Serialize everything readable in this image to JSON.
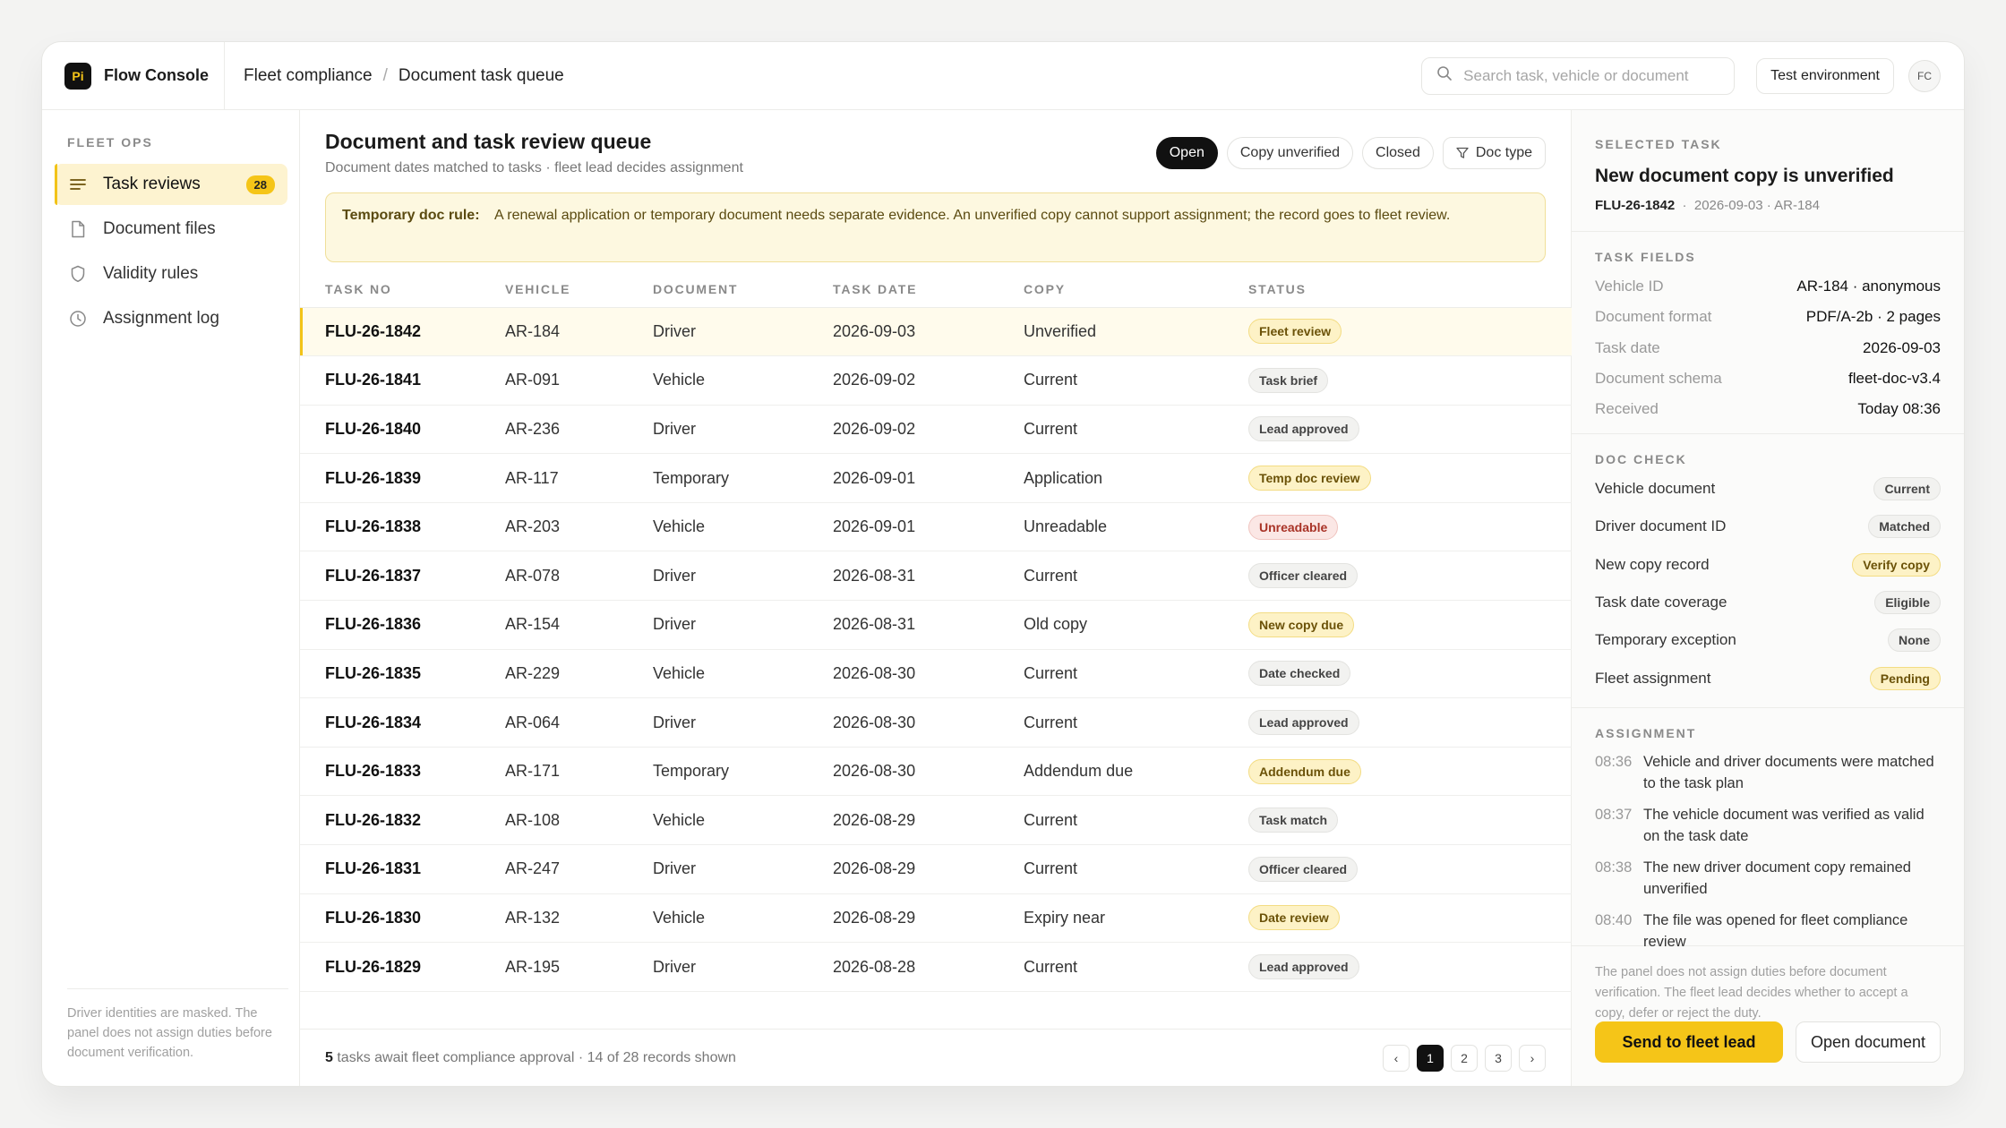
{
  "app": {
    "logo_text": "Pi",
    "name": "Flow Console"
  },
  "breadcrumb": [
    "Fleet compliance",
    "Document task queue"
  ],
  "search": {
    "placeholder": "Search task, vehicle or document",
    "value": ""
  },
  "environment_label": "Test environment",
  "avatar_initials": "FC",
  "sidebar": {
    "section_title": "FLEET OPS",
    "items": [
      {
        "label": "Task reviews",
        "icon": "list-icon",
        "badge": "28",
        "active": true
      },
      {
        "label": "Document files",
        "icon": "file-icon"
      },
      {
        "label": "Validity rules",
        "icon": "shield-icon"
      },
      {
        "label": "Assignment log",
        "icon": "clock-icon"
      }
    ],
    "note": "Driver identities are masked. The panel does not assign duties before document verification."
  },
  "main": {
    "title": "Document and task review queue",
    "subtitle": "Document dates matched to tasks · fleet lead decides assignment",
    "filters": [
      {
        "label": "Open",
        "active": true
      },
      {
        "label": "Copy unverified"
      },
      {
        "label": "Closed"
      },
      {
        "label": "Doc type",
        "icon": "filter-icon"
      }
    ],
    "rule": {
      "label": "Temporary doc rule:",
      "text": "A renewal application or temporary document needs separate evidence. An unverified copy cannot support assignment; the record goes to fleet review."
    },
    "columns": [
      "TASK NO",
      "VEHICLE",
      "DOCUMENT",
      "TASK DATE",
      "COPY",
      "STATUS"
    ],
    "rows": [
      {
        "task": "FLU-26-1842",
        "vehicle": "AR-184",
        "document": "Driver",
        "date": "2026-09-03",
        "copy": "Unverified",
        "status": "Fleet review",
        "tone": "yellow",
        "selected": true
      },
      {
        "task": "FLU-26-1841",
        "vehicle": "AR-091",
        "document": "Vehicle",
        "date": "2026-09-02",
        "copy": "Current",
        "status": "Task brief",
        "tone": "gray"
      },
      {
        "task": "FLU-26-1840",
        "vehicle": "AR-236",
        "document": "Driver",
        "date": "2026-09-02",
        "copy": "Current",
        "status": "Lead approved",
        "tone": "gray"
      },
      {
        "task": "FLU-26-1839",
        "vehicle": "AR-117",
        "document": "Temporary",
        "date": "2026-09-01",
        "copy": "Application",
        "status": "Temp doc review",
        "tone": "yellow"
      },
      {
        "task": "FLU-26-1838",
        "vehicle": "AR-203",
        "document": "Vehicle",
        "date": "2026-09-01",
        "copy": "Unreadable",
        "status": "Unreadable",
        "tone": "red"
      },
      {
        "task": "FLU-26-1837",
        "vehicle": "AR-078",
        "document": "Driver",
        "date": "2026-08-31",
        "copy": "Current",
        "status": "Officer cleared",
        "tone": "gray"
      },
      {
        "task": "FLU-26-1836",
        "vehicle": "AR-154",
        "document": "Driver",
        "date": "2026-08-31",
        "copy": "Old copy",
        "status": "New copy due",
        "tone": "yellow"
      },
      {
        "task": "FLU-26-1835",
        "vehicle": "AR-229",
        "document": "Vehicle",
        "date": "2026-08-30",
        "copy": "Current",
        "status": "Date checked",
        "tone": "gray"
      },
      {
        "task": "FLU-26-1834",
        "vehicle": "AR-064",
        "document": "Driver",
        "date": "2026-08-30",
        "copy": "Current",
        "status": "Lead approved",
        "tone": "gray"
      },
      {
        "task": "FLU-26-1833",
        "vehicle": "AR-171",
        "document": "Temporary",
        "date": "2026-08-30",
        "copy": "Addendum due",
        "status": "Addendum due",
        "tone": "yellow"
      },
      {
        "task": "FLU-26-1832",
        "vehicle": "AR-108",
        "document": "Vehicle",
        "date": "2026-08-29",
        "copy": "Current",
        "status": "Task match",
        "tone": "gray"
      },
      {
        "task": "FLU-26-1831",
        "vehicle": "AR-247",
        "document": "Driver",
        "date": "2026-08-29",
        "copy": "Current",
        "status": "Officer cleared",
        "tone": "gray"
      },
      {
        "task": "FLU-26-1830",
        "vehicle": "AR-132",
        "document": "Vehicle",
        "date": "2026-08-29",
        "copy": "Expiry near",
        "status": "Date review",
        "tone": "yellow"
      },
      {
        "task": "FLU-26-1829",
        "vehicle": "AR-195",
        "document": "Driver",
        "date": "2026-08-28",
        "copy": "Current",
        "status": "Lead approved",
        "tone": "gray"
      }
    ],
    "footer": {
      "count": "5",
      "text": " tasks await fleet compliance approval · 14 of 28 records shown"
    },
    "pager": {
      "prev": "‹",
      "pages": [
        "1",
        "2",
        "3"
      ],
      "current": "1",
      "next": "›"
    }
  },
  "panel": {
    "selected_label": "SELECTED TASK",
    "title": "New document copy is unverified",
    "task_id": "FLU-26-1842",
    "meta": "2026-09-03 · AR-184",
    "fields_label": "TASK FIELDS",
    "fields": [
      {
        "key": "Vehicle ID",
        "value": "AR-184 · anonymous"
      },
      {
        "key": "Document format",
        "value": "PDF/A-2b · 2 pages"
      },
      {
        "key": "Task date",
        "value": "2026-09-03"
      },
      {
        "key": "Document schema",
        "value": "fleet-doc-v3.4"
      },
      {
        "key": "Received",
        "value": "Today 08:36"
      }
    ],
    "doccheck_label": "DOC CHECK",
    "checks": [
      {
        "label": "Vehicle document",
        "value": "Current",
        "tone": "gray"
      },
      {
        "label": "Driver document ID",
        "value": "Matched",
        "tone": "gray"
      },
      {
        "label": "New copy record",
        "value": "Verify copy",
        "tone": "yellow"
      },
      {
        "label": "Task date coverage",
        "value": "Eligible",
        "tone": "gray"
      },
      {
        "label": "Temporary exception",
        "value": "None",
        "tone": "gray"
      },
      {
        "label": "Fleet assignment",
        "value": "Pending",
        "tone": "yellow"
      }
    ],
    "assignment_label": "ASSIGNMENT",
    "log": [
      {
        "time": "08:36",
        "text": "Vehicle and driver documents were matched to the task plan"
      },
      {
        "time": "08:37",
        "text": "The vehicle document was verified as valid on the task date"
      },
      {
        "time": "08:38",
        "text": "The new driver document copy remained unverified"
      },
      {
        "time": "08:40",
        "text": "The file was opened for fleet compliance review"
      }
    ],
    "note": "The panel does not assign duties before document verification. The fleet lead decides whether to accept a copy, defer or reject the duty.",
    "primary_button": "Send to fleet lead",
    "secondary_button": "Open document"
  }
}
